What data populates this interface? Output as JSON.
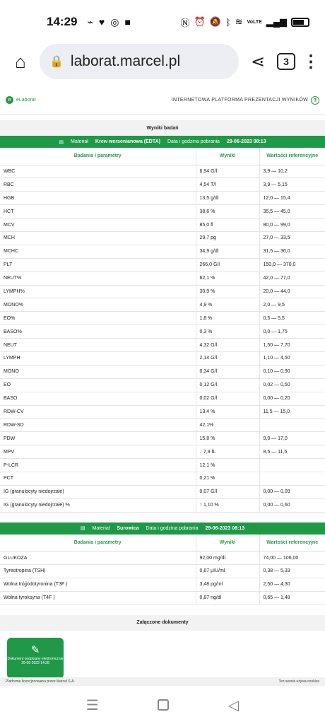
{
  "status": {
    "time": "14:29",
    "notif_icons": [
      "messenger-icon",
      "heart-icon",
      "instagram-icon",
      "bag-icon",
      "nfc-icon",
      "alarm-icon",
      "mute-icon",
      "bluetooth-icon",
      "wifi-icon"
    ],
    "volte": "VoLTE",
    "signal": "signal-icon"
  },
  "browser": {
    "url": "laborat.marcel.pl",
    "tab_count": "3"
  },
  "site": {
    "logo_text": "eLaborat",
    "tagline": "INTERNETOWA PLATFORMA PREZENTACJI WYNIKÓW"
  },
  "results": {
    "title": "Wyniki badań",
    "headers": {
      "param": "Badania i parametry",
      "result": "Wyniki",
      "ref": "Wartości referencyjne"
    }
  },
  "material1": {
    "label": "Materiał",
    "value": "Krew wersenianowa (EDTA)",
    "date_label": "Data i godzina pobrania",
    "date_value": "29-06-2023 08:13",
    "rows": [
      [
        "WBC",
        "6,94 G/l",
        "3,9 — 10,2"
      ],
      [
        "RBC",
        "4,54 T/l",
        "3,9 — 5,15"
      ],
      [
        "HGB",
        "13,5 g/dl",
        "12,0 — 15,4"
      ],
      [
        "HCT",
        "38,6 %",
        "35,5 — 45,0"
      ],
      [
        "MCV",
        "85,0 fl",
        "80,0 — 99,0"
      ],
      [
        "MCH",
        "29,7 pg",
        "27,0 — 33,5"
      ],
      [
        "MCHC",
        "34,9 g/dl",
        "31,5 — 36,0"
      ],
      [
        "PLT",
        "266,0 G/l",
        "150,0 — 370,0"
      ],
      [
        "NEUT%",
        "62,1 %",
        "42,0 — 77,0"
      ],
      [
        "LYMPH%",
        "30,9 %",
        "20,0 — 44,0"
      ],
      [
        "MONO%",
        "4,9 %",
        "2,0 — 9,5"
      ],
      [
        "EO%",
        "1,8 %",
        "0,5 — 5,5"
      ],
      [
        "BASO%",
        "0,3 %",
        "0,0 — 1,75"
      ],
      [
        "NEUT",
        "4,32 G/l",
        "1,50 — 7,70"
      ],
      [
        "LYMPH",
        "2,14 G/l",
        "1,10 — 4,50"
      ],
      [
        "MONO",
        "0,34 G/l",
        "0,10 — 0,90"
      ],
      [
        "EO",
        "0,12 G/l",
        "0,02 — 0,50"
      ],
      [
        "BASO",
        "0,02 G/l",
        "0,00 — 0,20"
      ],
      [
        "RDW-CV",
        "13,4 %",
        "11,5 — 15,0"
      ],
      [
        "RDW-SD",
        "42,1%",
        ""
      ],
      [
        "PDW",
        "15,8 %",
        "9,0 — 17,0"
      ],
      [
        "MPV",
        "↓ 7,9 fL",
        "8,5 — 11,5"
      ],
      [
        "P-LCR",
        "12,1 %",
        ""
      ],
      [
        "PCT",
        "0,21 %",
        ""
      ],
      [
        "IG (granulocyty niedojrzałe)",
        "0,07 G/l",
        "0,00 — 0,09"
      ],
      [
        "IG (granulocyty niedojrzałe) %",
        "↑ 1,10 %",
        "0,00 — 0,60"
      ]
    ]
  },
  "material2": {
    "label": "Materiał",
    "value": "Surowica",
    "date_label": "Data i godzina pobrania",
    "date_value": "29-06-2023 08:13",
    "rows": [
      [
        "GLUKOZA",
        "92,00 mg/dl",
        "74,00 — 106,00"
      ],
      [
        "Tyreotropina (TSH)",
        "0,67 µIU/ml",
        "0,38 — 5,33"
      ],
      [
        "Wolna trójjodotyronina (T3F )",
        "3,48 pg/ml",
        "2,50 — 4,30"
      ],
      [
        "Wolna tyroksyna (T4F )",
        "0,87 ng/dl",
        "0,65 — 1,48"
      ]
    ]
  },
  "docs": {
    "title": "Załączone dokumenty",
    "card_label": "Dokument podpisany elektronicznie",
    "card_date": "29-06-2023 14:28"
  },
  "footer": {
    "left": "Platforma licencjonowana przez Marcel S.A.",
    "right": "Ten serwis używa cookies"
  }
}
